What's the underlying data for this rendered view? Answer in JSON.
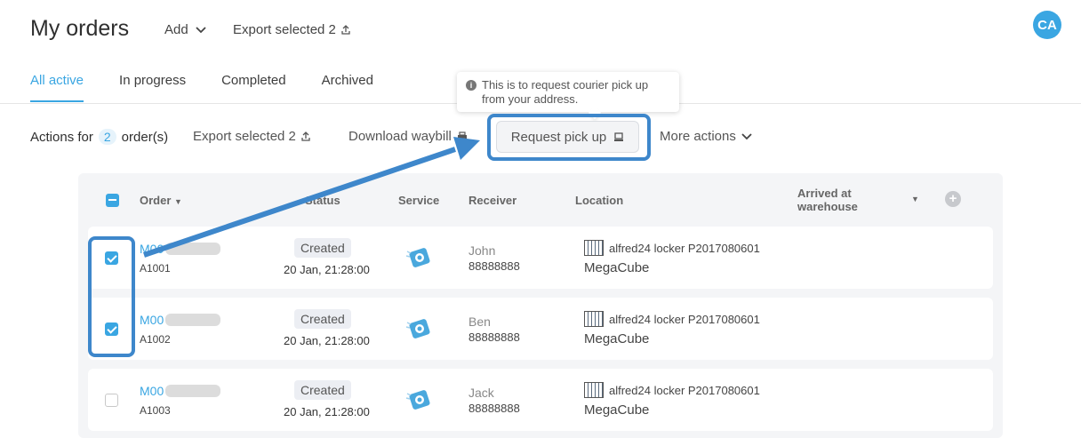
{
  "header": {
    "title": "My orders",
    "add_label": "Add",
    "export_label": "Export selected 2",
    "avatar_initials": "CA"
  },
  "tabs": [
    {
      "label": "All active",
      "active": true
    },
    {
      "label": "In progress"
    },
    {
      "label": "Completed"
    },
    {
      "label": "Archived"
    }
  ],
  "tooltip": {
    "text": "This is to request courier pick up from your address."
  },
  "actions": {
    "prefix": "Actions for",
    "count": "2",
    "suffix": "order(s)",
    "export_label": "Export selected 2",
    "waybill_label": "Download waybill",
    "request_label": "Request pick up",
    "more_label": "More actions"
  },
  "table": {
    "headers": {
      "order": "Order",
      "status": "Status",
      "service": "Service",
      "receiver": "Receiver",
      "location": "Location",
      "arrived": "Arrived at warehouse"
    },
    "rows": [
      {
        "order_prefix": "M00",
        "order_sub": "A1001",
        "status": "Created",
        "date": "20 Jan, 21:28:00",
        "receiver": "John",
        "phone": "88888888",
        "locker": "alfred24 locker P2017080601",
        "location": "MegaCube",
        "checked": true
      },
      {
        "order_prefix": "M00",
        "order_sub": "A1002",
        "status": "Created",
        "date": "20 Jan, 21:28:00",
        "receiver": "Ben",
        "phone": "88888888",
        "locker": "alfred24 locker P2017080601",
        "location": "MegaCube",
        "checked": true
      },
      {
        "order_prefix": "M00",
        "order_sub": "A1003",
        "status": "Created",
        "date": "20 Jan, 21:28:00",
        "receiver": "Jack",
        "phone": "88888888",
        "locker": "alfred24 locker P2017080601",
        "location": "MegaCube",
        "checked": false
      }
    ]
  },
  "colors": {
    "accent": "#3aa6e2",
    "highlight": "#3e87cb"
  }
}
